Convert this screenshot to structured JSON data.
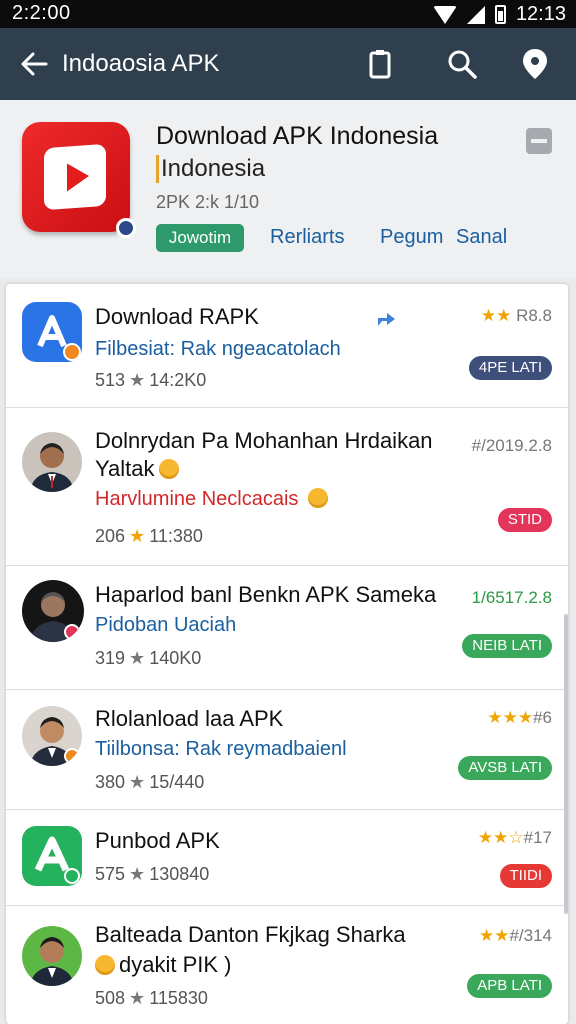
{
  "status_bar": {
    "time": "2:2:00",
    "clock": "12:13"
  },
  "app_bar": {
    "title": "Indoaosia APK"
  },
  "header": {
    "title": "Download APK Indonesia",
    "subtitle": "Indonesia",
    "meta": "2PK 2:k 1/10",
    "chip": "Jowotim",
    "links": [
      "Rerliarts",
      "Pegum",
      "Sanal"
    ]
  },
  "items": [
    {
      "title": "Download RAPK",
      "subtitle": "Filbesiat: Rak ngeacatolach",
      "subtitle_color": "#1b5fa0",
      "stats_count": "513",
      "stats_value": "14:2K0",
      "star_style": "gray",
      "rating_stars": "★★",
      "rating_text": "R8.8",
      "badge": "4PE LATI",
      "badge_color": "navy"
    },
    {
      "title": "Dolnrydan Pa Mohanhan Hrdaikan",
      "title_line2": "Yaltak",
      "subtitle": "Harvlumine Neclcacais",
      "subtitle_color": "#d3282a",
      "stats_count": "206",
      "stats_value": "11:380",
      "star_style": "gold",
      "rating_stars": "",
      "rating_text": "#/2019.2.8",
      "badge": "STID",
      "badge_color": "red"
    },
    {
      "title": "Haparlod banl Benkn APK Sameka",
      "subtitle": "Pidoban Uaciah",
      "subtitle_color": "#1b5fa0",
      "stats_count": "319",
      "stats_value": "140K0",
      "star_style": "gray",
      "rating_stars": "",
      "rating_text": "1/6517.2.8",
      "badge": "NEIB LATI",
      "badge_color": "green"
    },
    {
      "title": "Rlolanload laa APK",
      "subtitle": "Tiilbonsa: Rak reymadbaienl",
      "subtitle_color": "#1b5fa0",
      "stats_count": "380",
      "stats_value": "15/440",
      "star_style": "gray",
      "rating_stars": "★★★",
      "rating_text": "#6",
      "badge": "AVSB LATI",
      "badge_color": "green"
    },
    {
      "title": "Punbod APK",
      "subtitle": "",
      "subtitle_color": "#1b5fa0",
      "stats_count": "575",
      "stats_value": "130840",
      "star_style": "gray",
      "rating_stars": "★★☆",
      "rating_text": "#17",
      "badge": "TIIDI",
      "badge_color": "red2"
    },
    {
      "title": "Balteada Danton Fkjkag Sharka",
      "title_line2": "dyakit PIK )",
      "subtitle": "",
      "subtitle_color": "#1b5fa0",
      "stats_count": "508",
      "stats_value": "115830",
      "star_style": "gray",
      "rating_stars": "★★",
      "rating_text": "#/314",
      "badge": "APB LATI",
      "badge_color": "green"
    }
  ],
  "colors": {
    "app_bar": "#2f3f4d",
    "chip_green": "#2e9a6b",
    "link_blue": "#1b5fa0",
    "star_gold": "#f0a400"
  }
}
